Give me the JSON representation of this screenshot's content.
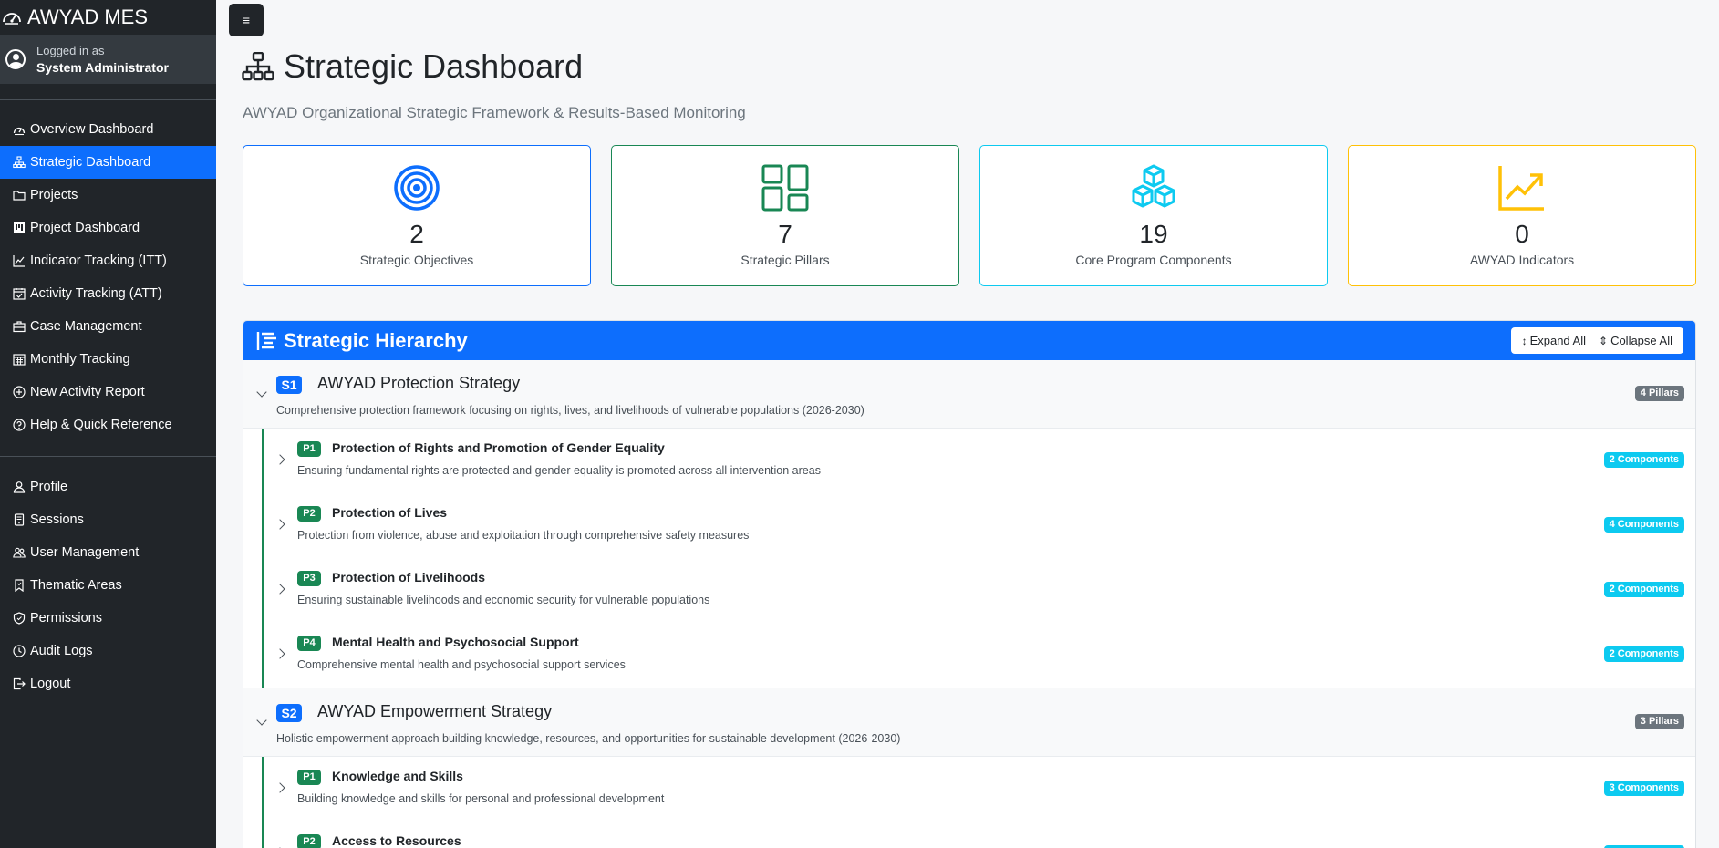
{
  "app": {
    "brand": "AWYAD MES",
    "logged_in_as": "Logged in as",
    "user_name": "System Administrator",
    "toggle_symbol": "≡"
  },
  "nav_main": [
    {
      "label": "Overview Dashboard",
      "icon": "speedometer-icon"
    },
    {
      "label": "Strategic Dashboard",
      "icon": "diagram-icon",
      "active": true
    },
    {
      "label": "Projects",
      "icon": "folder-icon"
    },
    {
      "label": "Project Dashboard",
      "icon": "kanban-icon"
    },
    {
      "label": "Indicator Tracking (ITT)",
      "icon": "graph-up-icon"
    },
    {
      "label": "Activity Tracking (ATT)",
      "icon": "calendar-check-icon"
    },
    {
      "label": "Case Management",
      "icon": "briefcase-icon"
    },
    {
      "label": "Monthly Tracking",
      "icon": "calendar-grid-icon"
    },
    {
      "label": "New Activity Report",
      "icon": "plus-circle-icon"
    },
    {
      "label": "Help & Quick Reference",
      "icon": "question-circle-icon"
    }
  ],
  "nav_admin": [
    {
      "label": "Profile",
      "icon": "person-icon"
    },
    {
      "label": "Sessions",
      "icon": "phone-icon"
    },
    {
      "label": "User Management",
      "icon": "people-icon"
    },
    {
      "label": "Thematic Areas",
      "icon": "bookmark-icon"
    },
    {
      "label": "Permissions",
      "icon": "shield-icon"
    },
    {
      "label": "Audit Logs",
      "icon": "clock-icon"
    },
    {
      "label": "Logout",
      "icon": "logout-icon"
    }
  ],
  "header": {
    "title": "Strategic Dashboard",
    "subtitle": "AWYAD Organizational Strategic Framework & Results-Based Monitoring"
  },
  "stats": [
    {
      "value": "2",
      "label": "Strategic Objectives",
      "color": "#0d6efd",
      "icon": "bullseye-icon"
    },
    {
      "value": "7",
      "label": "Strategic Pillars",
      "color": "#198754",
      "icon": "grid-icon"
    },
    {
      "value": "19",
      "label": "Core Program Components",
      "color": "#0dcaf0",
      "icon": "boxes-icon"
    },
    {
      "value": "0",
      "label": "AWYAD Indicators",
      "color": "#ffc107",
      "icon": "chart-line-icon"
    }
  ],
  "hierarchy": {
    "title": "Strategic Hierarchy",
    "expand_label": "Expand All",
    "collapse_label": "Collapse All",
    "strategies": [
      {
        "code": "S1",
        "title": "AWYAD Protection Strategy",
        "description": "Comprehensive protection framework focusing on rights, lives, and livelihoods of vulnerable populations (2026-2030)",
        "count": "4 Pillars",
        "pillars": [
          {
            "code": "P1",
            "title": "Protection of Rights and Promotion of Gender Equality",
            "description": "Ensuring fundamental rights are protected and gender equality is promoted across all intervention areas",
            "count": "2 Components"
          },
          {
            "code": "P2",
            "title": "Protection of Lives",
            "description": "Protection from violence, abuse and exploitation through comprehensive safety measures",
            "count": "4 Components"
          },
          {
            "code": "P3",
            "title": "Protection of Livelihoods",
            "description": "Ensuring sustainable livelihoods and economic security for vulnerable populations",
            "count": "2 Components"
          },
          {
            "code": "P4",
            "title": "Mental Health and Psychosocial Support",
            "description": "Comprehensive mental health and psychosocial support services",
            "count": "2 Components"
          }
        ]
      },
      {
        "code": "S2",
        "title": "AWYAD Empowerment Strategy",
        "description": "Holistic empowerment approach building knowledge, resources, and opportunities for sustainable development (2026-2030)",
        "count": "3 Pillars",
        "pillars": [
          {
            "code": "P1",
            "title": "Knowledge and Skills",
            "description": "Building knowledge and skills for personal and professional development",
            "count": "3 Components"
          },
          {
            "code": "P2",
            "title": "Access to Resources",
            "description": "",
            "count": ""
          }
        ]
      }
    ]
  }
}
